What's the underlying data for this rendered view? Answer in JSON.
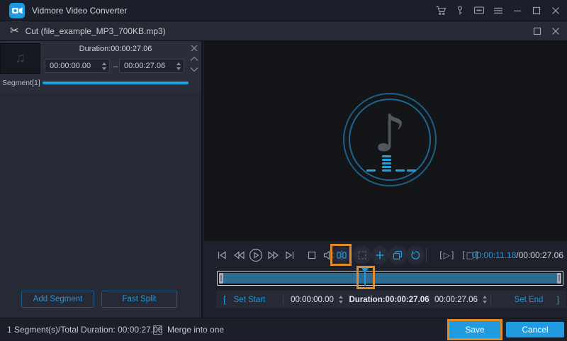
{
  "titlebar": {
    "app_title": "Vidmore Video Converter"
  },
  "dialog": {
    "title": "Cut (file_example_MP3_700KB.mp3)"
  },
  "segment_panel": {
    "duration_label": "Duration:00:00:27.06",
    "start_time": "00:00:00.00",
    "range_dash": "–",
    "end_time": "00:00:27.06",
    "segment_label": "Segment[1]",
    "add_segment_button": "Add Segment",
    "fast_split_button": "Fast Split"
  },
  "player": {
    "current_time": "00:00:11.18",
    "duration_suffix": "/00:00:27.06"
  },
  "trim_bar": {
    "open_bracket": "[",
    "set_start_button": "Set Start",
    "start_time": "00:00:00.00",
    "duration_label": "Duration:00:00:27.06",
    "end_time": "00:00:27.06",
    "set_end_button": "Set End",
    "close_bracket": "]"
  },
  "footer": {
    "summary": "1 Segment(s)/Total Duration: 00:00:27.06",
    "merge_checkbox_label": "Merge into one",
    "save_button": "Save",
    "cancel_button": "Cancel"
  },
  "icons": {
    "scissors": "✂",
    "music_note": "♪",
    "thumbnail_note": "♫",
    "segment_play": "[▷]",
    "segment_stop": "[□]"
  },
  "colors": {
    "accent_blue": "#2196d9",
    "progress_blue": "#1e9fe0",
    "timeline_fill": "#2c6c92",
    "annotation_orange": "#e08a28"
  }
}
